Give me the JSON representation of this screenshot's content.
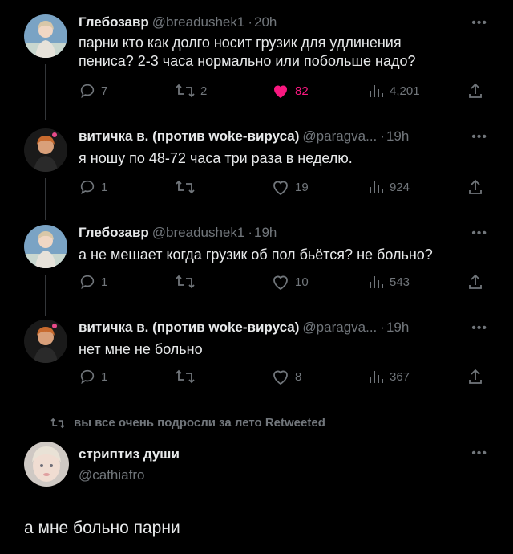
{
  "tweets": [
    {
      "name": "Глебозавр",
      "handle": "@breadushek1",
      "time": "20h",
      "text_lines": [
        "парни кто как долго носит грузик для удлинения",
        "пениса? 2-3 часа нормально или побольше надо?"
      ],
      "replies": "7",
      "retweets": "2",
      "likes": "82",
      "views": "4,201",
      "liked": true,
      "avatar_colors": {
        "bg": "#7aa3c4",
        "hair": "#d9c7a8",
        "skin": "#f1d7c4",
        "shirt": "#e6e2da"
      }
    },
    {
      "name": "витичка в. (против woke-вируса)",
      "handle": "@paragva...",
      "time": "19h",
      "text_lines": [
        "я ношу по 48-72 часа три раза в неделю."
      ],
      "replies": "1",
      "retweets": "",
      "likes": "19",
      "views": "924",
      "liked": false,
      "avatar_colors": {
        "bg": "#1a1a1a",
        "hair": "#c86a2e",
        "skin": "#d9a07a",
        "shirt": "#2a2a2a"
      }
    },
    {
      "name": "Глебозавр",
      "handle": "@breadushek1",
      "time": "19h",
      "text_lines": [
        "а не мешает когда грузик об пол бьётся? не больно?"
      ],
      "replies": "1",
      "retweets": "",
      "likes": "10",
      "views": "543",
      "liked": false,
      "avatar_colors": {
        "bg": "#7aa3c4",
        "hair": "#d9c7a8",
        "skin": "#f1d7c4",
        "shirt": "#e6e2da"
      }
    },
    {
      "name": "витичка в. (против woke-вируса)",
      "handle": "@paragva...",
      "time": "19h",
      "text_lines": [
        "нет мне не больно"
      ],
      "replies": "1",
      "retweets": "",
      "likes": "8",
      "views": "367",
      "liked": false,
      "avatar_colors": {
        "bg": "#1a1a1a",
        "hair": "#c86a2e",
        "skin": "#d9a07a",
        "shirt": "#2a2a2a"
      }
    }
  ],
  "retweet_note": "вы все очень подросли за лето Retweeted",
  "quote": {
    "name": "стриптиз души",
    "handle": "@cathiafro",
    "text": "а мне больно парни"
  },
  "separator": "·",
  "more_icon": "more-dots-icon"
}
